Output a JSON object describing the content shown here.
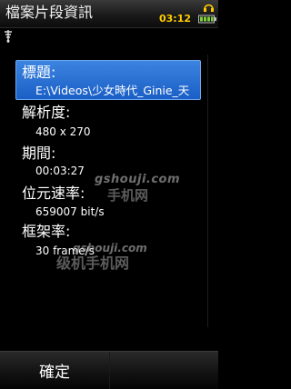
{
  "header": {
    "title": "檔案片段資訊",
    "time": "03:12"
  },
  "icons": {
    "headset": "headset-icon",
    "battery": "battery-icon",
    "signal": "signal-icon"
  },
  "fields": [
    {
      "label": "標題:",
      "value": "E:\\Videos\\少女時代_Ginie_天"
    },
    {
      "label": "解析度:",
      "value": "480 x 270"
    },
    {
      "label": "期間:",
      "value": "00:03:27"
    },
    {
      "label": "位元速率:",
      "value": "659007 bit/s"
    },
    {
      "label": "框架率:",
      "value": "30 frame/s"
    }
  ],
  "watermarks": {
    "site_top": "gshouji.com",
    "brand_top": "手机网",
    "site_bottom": "gshouji.com",
    "brand_bottom": "级机手机网"
  },
  "softkeys": {
    "left": "確定",
    "right": ""
  },
  "colors": {
    "highlight": "#2f74d8",
    "clock": "#ffcc00",
    "background": "#000000"
  }
}
